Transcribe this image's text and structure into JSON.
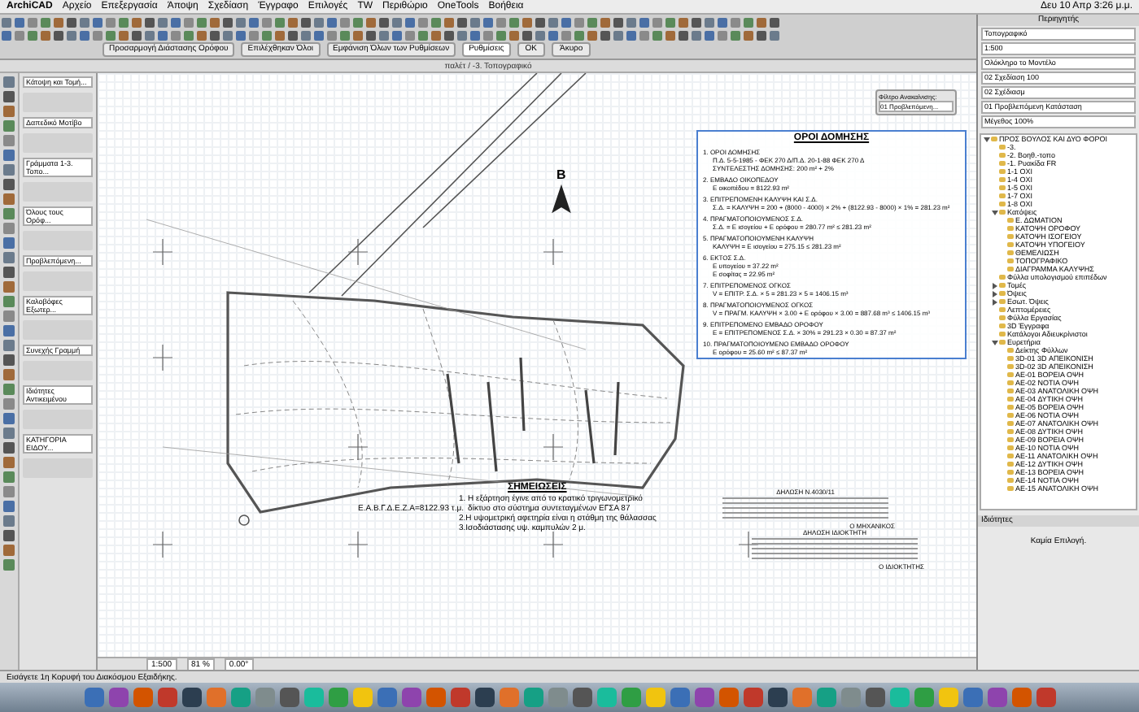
{
  "menu_bar": {
    "app": "ArchiCAD",
    "items": [
      "Αρχείο",
      "Επεξεργασία",
      "Άποψη",
      "Σχεδίαση",
      "Έγγραφο",
      "Επιλογές",
      "TW",
      "Περιθώριο",
      "OneTools",
      "Βοήθεια"
    ],
    "clock": "Δευ 10 Απρ 3:26 μ.μ."
  },
  "toolbar": {
    "buttons": [
      "Προσαρμογή Διάστασης Ορόφου",
      "Επιλέχθηκαν Όλοι",
      "Εμφάνιση Όλων των Ρυθμίσεων"
    ],
    "layer_dropdown": "Ρυθμίσεις",
    "ok": "OK",
    "cancel": "Άκυρο"
  },
  "window": {
    "title": "παλέτ / -3. Τοπογραφικό"
  },
  "info_box": {
    "items": [
      "Κάτοψη και Τομή...",
      "Δαπεδικό Μοτίβο",
      "Γράμματα 1-3. Τοπο...",
      "Όλους τους Ορόφ...",
      "Προβλεπόμενη...",
      "Καλοβόφες Εξωτερ...",
      "Συνεχής Γραμμή",
      "Ιδιότητες Αντικειμένου",
      "ΚΑΤΗΓΟΡΙΑ ΕΙΔΟΥ..."
    ]
  },
  "canvas": {
    "north_label": "Β",
    "area_label": "Ε.Α.Β.Γ.Δ.Ε.Ζ.Α=8122.93 τ.μ.",
    "notes": {
      "title": "ΣΗΜΕΙΩΣΕΙΣ",
      "lines": [
        "1. Η εξάρτηση έγινε από το κρατικό τριγωνομετρικό",
        "    δίκτυο στο σύστημα συντεταγμένων ΕΓΣΑ 87",
        "2.Η υψομετρική αφετηρία είναι η στάθμη της θάλασσας",
        "3.Ισοδιάστασης υψ. καμπυλών 2 μ."
      ]
    },
    "terms": {
      "title": "ΟΡΟΙ ΔΟΜΗΣΗΣ",
      "sections": [
        {
          "heading": "1. ΟΡΟΙ ΔΟΜΗΣΗΣ",
          "lines": [
            "Π.Δ. 5-5-1985 - ΦΕΚ 270 Δ/Π.Δ. 20-1-88 ΦΕΚ 270 Δ",
            "ΣΥΝΤΕΛΕΣΤΗΣ ΔΟΜΗΣΗΣ: 200 m² + 2%"
          ]
        },
        {
          "heading": "2. ΕΜΒΑΔΟ ΟΙΚΟΠΕΔΟΥ",
          "lines": [
            "Ε οικοπέδου = 8122.93 m²"
          ]
        },
        {
          "heading": "3. ΕΠΙΤΡΕΠΟΜΕΝΗ ΚΑΛΥΨΗ ΚΑΙ Σ.Δ.",
          "lines": [
            "Σ.Δ. = ΚΑΛΥΨΗ = 200 + (8000 - 4000) × 2% + (8122.93 - 8000) × 1% = 281.23 m²"
          ]
        },
        {
          "heading": "4. ΠΡΑΓΜΑΤΟΠΟΙΟΥΜΕΝΟΣ Σ.Δ.",
          "lines": [
            "Σ.Δ. = Ε ισογείου + Ε ορόφου = 280.77 m² ≤ 281.23 m²"
          ]
        },
        {
          "heading": "5. ΠΡΑΓΜΑΤΟΠΟΙΟΥΜΕΝΗ ΚΑΛΥΨΗ",
          "lines": [
            "ΚΑΛΥΨΗ = Ε ισογείου = 275.15 ≤ 281.23 m²"
          ]
        },
        {
          "heading": "6. ΕΚΤΟΣ Σ.Δ.",
          "lines": [
            "Ε υπογείου = 37.22 m²",
            "Ε σοφίτας = 22.95 m²"
          ]
        },
        {
          "heading": "7. ΕΠΙΤΡΕΠΟΜΕΝΟΣ ΟΓΚΟΣ",
          "lines": [
            "V = ΕΠΙΤΡ. Σ.Δ. × 5 = 281.23 × 5 = 1406.15 m³"
          ]
        },
        {
          "heading": "8. ΠΡΑΓΜΑΤΟΠΟΙΟΥΜΕΝΟΣ ΟΓΚΟΣ",
          "lines": [
            "V = ΠΡΑΓΜ. ΚΑΛΥΨΗ × 3.00 + Ε ορόφου × 3.00 = 887.68 m³ ≤ 1406.15 m³"
          ]
        },
        {
          "heading": "9. ΕΠΙΤΡΕΠΟΜΕΝΟ ΕΜΒΑΔΟ ΟΡΟΦΟΥ",
          "lines": [
            "Ε = ΕΠΙΤΡΕΠΟΜΕΝΟΣ Σ.Δ. × 30% = 291.23 × 0.30 = 87.37 m²"
          ]
        },
        {
          "heading": "10. ΠΡΑΓΜΑΤΟΠΟΙΟΥΜΕΝΟ ΕΜΒΑΔΟ ΟΡΟΦΟΥ",
          "lines": [
            "Ε ορόφου = 25.60 m² ≤ 87.37 m²"
          ]
        }
      ]
    },
    "declaration_1": {
      "title": "ΔΗΛΩΣΗ Ν.4030/11",
      "signature": "Ο ΜΗΧΑΝΙΚΟΣ"
    },
    "declaration_2": {
      "title": "ΔΗΛΩΣΗ ΙΔΙΟΚΤΗΤΗ",
      "signature": "Ο ΙΔΙΟΚΤΗΤΗΣ"
    },
    "renovation": {
      "label": "Φίλτρο Ανακαίνισης:",
      "value": "01 Προβλεπόμενη..."
    },
    "bottom_bar": {
      "scale": "1:500",
      "zoom": "81 %",
      "angle": "0.00°"
    }
  },
  "navigator": {
    "title": "Περιηγητής",
    "dropdowns": [
      "Τοπογραφικό",
      "1:500",
      "Ολόκληρο το Μοντέλο",
      "02 Σχεδίαση 100",
      "02 Σχέδιασμ",
      "01 Προβλεπόμενη Κατάσταση",
      "Μέγεθος 100%"
    ],
    "tree": [
      {
        "label": "ΠΡΟΣ ΒΟΥΛΟΣ ΚΑΙ ΔΥΟ ΦΟΡΟΙ",
        "expanded": true,
        "children": [
          {
            "label": "-3."
          },
          {
            "label": "-2. Βοηθ.-τοπο"
          },
          {
            "label": "-1. Ρυακίδα FR"
          },
          {
            "label": "1-1 ΟΧΙ"
          },
          {
            "label": "1-4 ΟΧΙ"
          },
          {
            "label": "1-5 ΟΧΙ"
          },
          {
            "label": "1-7 ΟΧΙ"
          },
          {
            "label": "1-8 ΟΧΙ"
          },
          {
            "label": "Κατόψεις",
            "expanded": true,
            "children": [
              {
                "label": "Ε. ΔΩΜΑΤΙΟΝ"
              },
              {
                "label": "ΚΑΤΟΨΗ ΟΡΟΦΟΥ"
              },
              {
                "label": "ΚΑΤΟΨΗ ΙΣΟΓΕΙΟΥ"
              },
              {
                "label": "ΚΑΤΟΨΗ ΥΠΟΓΕΙΟΥ"
              },
              {
                "label": "ΘΕΜΕΛΙΩΣΗ"
              },
              {
                "label": "ΤΟΠΟΓΡΑΦΙΚΟ"
              },
              {
                "label": "ΔΙΑΓΡΑΜΜΑ ΚΑΛΥΨΗΣ"
              }
            ]
          },
          {
            "label": "Φύλλα υπολογισμού επιπέδων"
          },
          {
            "label": "Τομές",
            "expanded": false
          },
          {
            "label": "Όψεις",
            "expanded": false
          },
          {
            "label": "Εσωτ. Όψεις",
            "expanded": false
          },
          {
            "label": "Λεπτομέρειες"
          },
          {
            "label": "Φύλλα Εργασίας"
          },
          {
            "label": "3D Έγγραφα"
          },
          {
            "label": "Κατάλογοι Αδιευκρίνιστοι"
          },
          {
            "label": "Ευρετήρια",
            "expanded": true,
            "children": [
              {
                "label": "Δείκτης Φύλλων"
              },
              {
                "label": "3D-01 3D ΑΠΕΙΚΟΝΙΣΗ"
              },
              {
                "label": "3D-02 3D ΑΠΕΙΚΟΝΙΣΗ"
              },
              {
                "label": "AE-01 ΒΟΡΕΙΑ ΟΨΗ"
              },
              {
                "label": "AE-02 ΝΟΤΙΑ ΟΨΗ"
              },
              {
                "label": "AE-03 ΑΝΑΤΟΛΙΚΗ ΟΨΗ"
              },
              {
                "label": "AE-04 ΔΥΤΙΚΗ ΟΨΗ"
              },
              {
                "label": "AE-05 ΒΟΡΕΙΑ ΟΨΗ"
              },
              {
                "label": "AE-06 ΝΟΤΙΑ ΟΨΗ"
              },
              {
                "label": "AE-07 ΑΝΑΤΟΛΙΚΗ ΟΨΗ"
              },
              {
                "label": "AE-08 ΔΥΤΙΚΗ ΟΨΗ"
              },
              {
                "label": "AE-09 ΒΟΡΕΙΑ ΟΨΗ"
              },
              {
                "label": "AE-10 ΝΟΤΙΑ ΟΨΗ"
              },
              {
                "label": "AE-11 ΑΝΑΤΟΛΙΚΗ ΟΨΗ"
              },
              {
                "label": "AE-12 ΔΥΤΙΚΗ ΟΨΗ"
              },
              {
                "label": "AE-13 ΒΟΡΕΙΑ ΟΨΗ"
              },
              {
                "label": "AE-14 ΝΟΤΙΑ ΟΨΗ"
              },
              {
                "label": "AE-15 ΑΝΑΤΟΛΙΚΗ ΟΨΗ"
              }
            ]
          }
        ]
      }
    ],
    "properties_title": "Ιδιότητες",
    "properties_empty": "Καμία Επιλογή."
  },
  "status_bar": {
    "text": "Εισάγετε 1η Κορυφή του Διακόσμου Εξαιδήκης."
  }
}
